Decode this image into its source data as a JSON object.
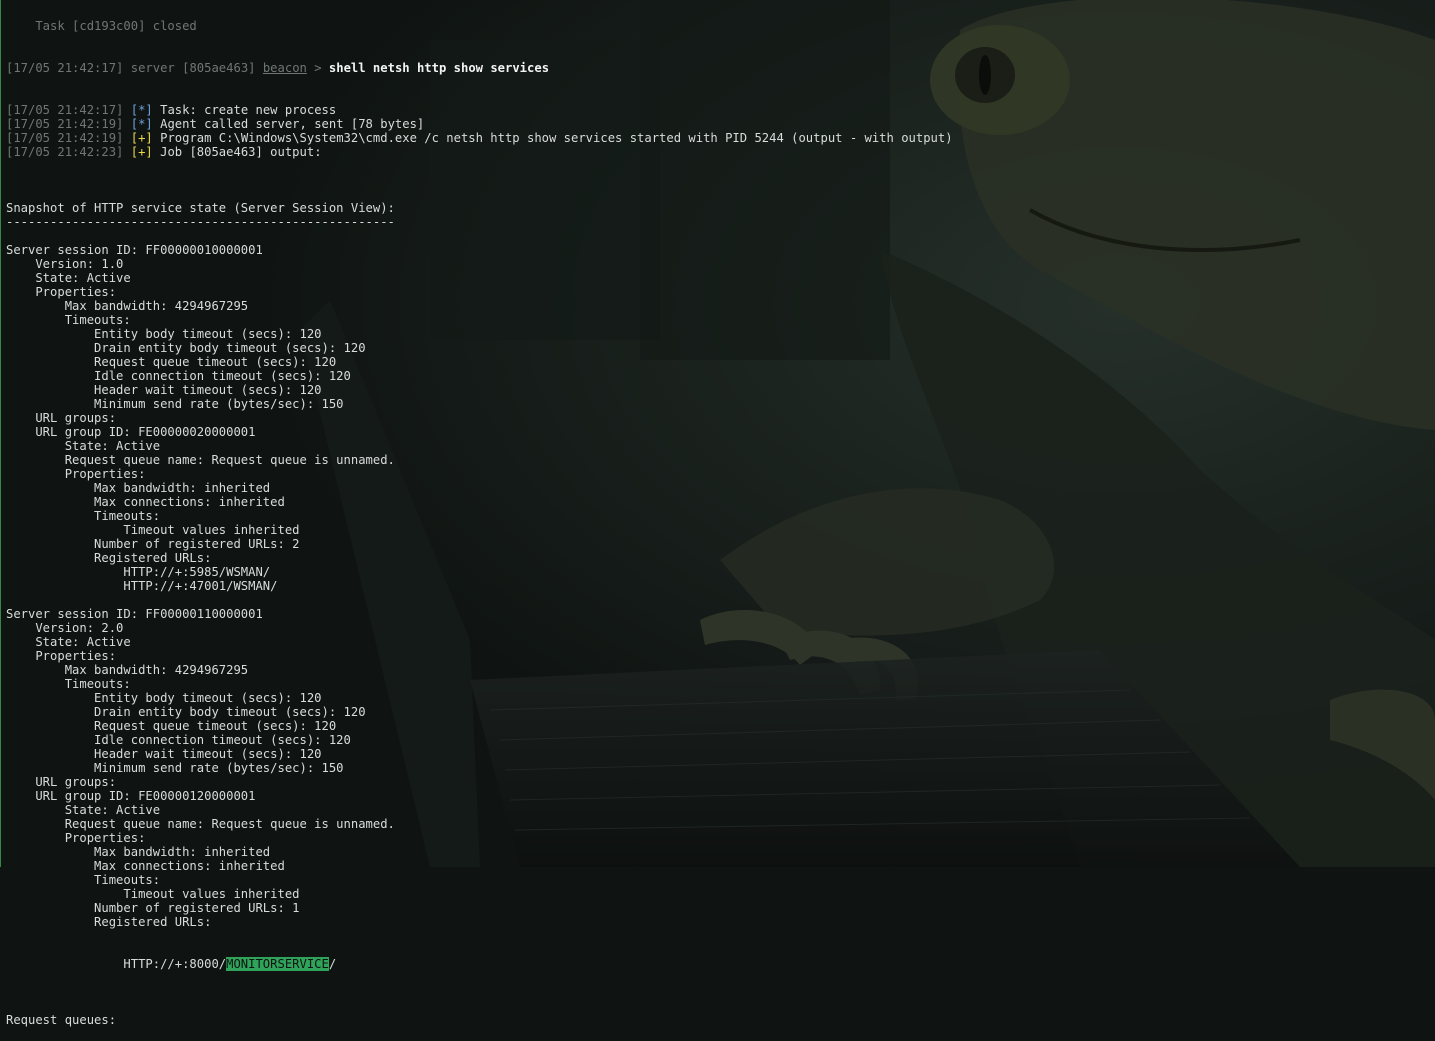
{
  "terminal": {
    "top_fragment": "    Task [cd193c00] closed",
    "prompt": {
      "timestamp": "[17/05 21:42:17]",
      "server": "server",
      "agent_id": "[805ae463]",
      "agent_name": "beacon",
      "arrow": ">",
      "command": "shell netsh http show services"
    },
    "log": [
      {
        "timestamp": "[17/05 21:42:17]",
        "marker": "[*]",
        "text": "Task: create new process"
      },
      {
        "timestamp": "[17/05 21:42:19]",
        "marker": "[*]",
        "text": "Agent called server, sent [78 bytes]"
      },
      {
        "timestamp": "[17/05 21:42:19]",
        "marker": "[+]",
        "text": "Program C:\\Windows\\System32\\cmd.exe /c netsh http show services started with PID 5244 (output - with output)"
      },
      {
        "timestamp": "[17/05 21:42:23]",
        "marker": "[+]",
        "text": "Job [805ae463] output:"
      }
    ],
    "output": {
      "lines_before_highlight": [
        "",
        "Snapshot of HTTP service state (Server Session View):",
        "-----------------------------------------------------",
        "",
        "Server session ID: FF00000010000001",
        "    Version: 1.0",
        "    State: Active",
        "    Properties:",
        "        Max bandwidth: 4294967295",
        "        Timeouts:",
        "            Entity body timeout (secs): 120",
        "            Drain entity body timeout (secs): 120",
        "            Request queue timeout (secs): 120",
        "            Idle connection timeout (secs): 120",
        "            Header wait timeout (secs): 120",
        "            Minimum send rate (bytes/sec): 150",
        "    URL groups:",
        "    URL group ID: FE00000020000001",
        "        State: Active",
        "        Request queue name: Request queue is unnamed.",
        "        Properties:",
        "            Max bandwidth: inherited",
        "            Max connections: inherited",
        "            Timeouts:",
        "                Timeout values inherited",
        "            Number of registered URLs: 2",
        "            Registered URLs:",
        "                HTTP://+:5985/WSMAN/",
        "                HTTP://+:47001/WSMAN/",
        "",
        "Server session ID: FF00000110000001",
        "    Version: 2.0",
        "    State: Active",
        "    Properties:",
        "        Max bandwidth: 4294967295",
        "        Timeouts:",
        "            Entity body timeout (secs): 120",
        "            Drain entity body timeout (secs): 120",
        "            Request queue timeout (secs): 120",
        "            Idle connection timeout (secs): 120",
        "            Header wait timeout (secs): 120",
        "            Minimum send rate (bytes/sec): 150",
        "    URL groups:",
        "    URL group ID: FE00000120000001",
        "        State: Active",
        "        Request queue name: Request queue is unnamed.",
        "        Properties:",
        "            Max bandwidth: inherited",
        "            Max connections: inherited",
        "            Timeouts:",
        "                Timeout values inherited",
        "            Number of registered URLs: 1",
        "            Registered URLs:"
      ],
      "highlight_line": {
        "prefix": "                HTTP://+:8000/",
        "highlight": "MONITORSERVICE",
        "suffix": "/"
      },
      "lines_after_highlight": [
        "",
        "Request queues:"
      ]
    }
  },
  "colors": {
    "background": "#0f1412",
    "text": "#d8dcda",
    "timestamp": "#6f7774",
    "info_marker": "#6fa0d8",
    "success_marker": "#e8d84a",
    "highlight": "#2fa35a",
    "border": "#2f8a4a"
  },
  "background_image": "lizard-hacker-at-keyboard-artwork"
}
